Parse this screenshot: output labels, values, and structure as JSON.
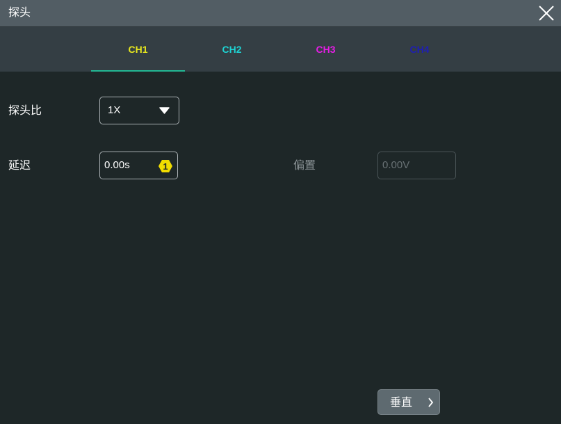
{
  "dialog": {
    "title": "探头",
    "close_icon": "close-icon"
  },
  "tabs": [
    {
      "label": "CH1",
      "color": "#e6e61e",
      "active": true
    },
    {
      "label": "CH2",
      "color": "#1ed2d2",
      "active": false
    },
    {
      "label": "CH3",
      "color": "#e61ee6",
      "active": false
    },
    {
      "label": "CH4",
      "color": "#1e1eb4",
      "active": false
    }
  ],
  "probe_ratio": {
    "label": "探头比",
    "value": "1X",
    "icon": "caret-down-icon"
  },
  "delay": {
    "label": "延迟",
    "value": "0.00s",
    "badge": "1",
    "badge_color": "#f0dc00"
  },
  "offset": {
    "label": "偏置",
    "value": "0.00V"
  },
  "vertical_button": {
    "label": "垂直",
    "icon": "chevron-right-icon"
  },
  "colors": {
    "accent": "#23b894",
    "background": "#1e2728",
    "titlebar": "#525d64",
    "tabbar": "#343e44"
  }
}
